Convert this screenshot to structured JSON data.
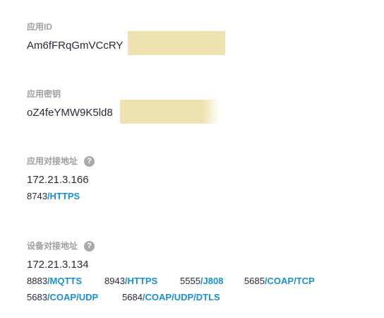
{
  "app_id": {
    "label": "应用ID",
    "value": "Am6fFRqGmVCcRY"
  },
  "app_secret": {
    "label": "应用密钥",
    "value": "oZ4feYMW9K5ld8"
  },
  "app_access": {
    "label": "应用对接地址",
    "help_icon": "question-circle-icon",
    "help_glyph": "?",
    "address": "172.21.3.166",
    "ports": [
      {
        "port": "8743",
        "sep": "/",
        "protocol": "HTTPS"
      }
    ]
  },
  "device_access": {
    "label": "设备对接地址",
    "help_icon": "question-circle-icon",
    "help_glyph": "?",
    "address": "172.21.3.134",
    "ports": [
      {
        "port": "8883",
        "sep": "/",
        "protocol": "MQTTS"
      },
      {
        "port": "8943",
        "sep": "/",
        "protocol": "HTTPS"
      },
      {
        "port": "5555",
        "sep": "/",
        "protocol": "J808"
      },
      {
        "port": "5685",
        "sep": "/",
        "protocol": "COAP/TCP"
      },
      {
        "port": "5683",
        "sep": "/",
        "protocol": "COAP/UDP"
      },
      {
        "port": "5684",
        "sep": "/",
        "protocol": "COAP/UDP/DTLS"
      }
    ]
  },
  "colors": {
    "label": "#a0a0a0",
    "value": "#252b3a",
    "protocol_link": "#1a8fd6",
    "redaction": "#efe2b1"
  }
}
